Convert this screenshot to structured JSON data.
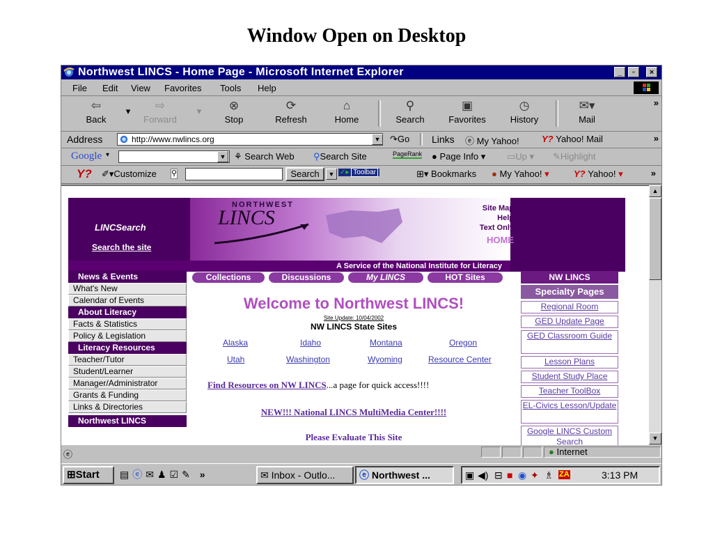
{
  "slide": {
    "title": "Window Open on Desktop"
  },
  "window": {
    "title": "Northwest LINCS - Home Page - Microsoft Internet Explorer",
    "min": "_",
    "max": "▫",
    "close": "×"
  },
  "menu": [
    "File",
    "Edit",
    "View",
    "Favorites",
    "Tools",
    "Help"
  ],
  "toolbar": {
    "back": "Back",
    "forward": "Forward",
    "stop": "Stop",
    "refresh": "Refresh",
    "home": "Home",
    "search": "Search",
    "favorites": "Favorites",
    "history": "History",
    "mail": "Mail",
    "more": "»"
  },
  "address": {
    "label": "Address",
    "url": "http://www.nwlincs.org",
    "go": "Go",
    "links_label": "Links",
    "link1": "My Yahoo!",
    "link2": "Yahoo! Mail",
    "more": "»"
  },
  "googlebar": {
    "logo": "Google",
    "search_web": "Search Web",
    "search_site": "Search Site",
    "pagerank": "PageRank",
    "page_info": "Page Info",
    "up": "Up",
    "highlight": "Highlight"
  },
  "yahoobar": {
    "logo": "Y?",
    "customize": "Customize",
    "search": "Search",
    "toolbar": "Toolbar",
    "bookmarks": "Bookmarks",
    "myyahoo": "My Yahoo!",
    "yahoo": "Yahoo!",
    "more": "»"
  },
  "page": {
    "banner": {
      "linc_search": "LINCSearch",
      "search_site": "Search the site",
      "northwest": "NORTHWEST",
      "lincs": "LINCS",
      "site_map": "Site Map",
      "help": "Help",
      "text_only": "Text Only",
      "home": "HOME",
      "service": "A Service of the National Institute for Literacy"
    },
    "tabs": [
      "Collections",
      "Discussions",
      "My LINCS",
      "HOT Sites"
    ],
    "leftnav": {
      "news_header": "News & Events",
      "news": [
        "What's New",
        "Calendar of Events"
      ],
      "about_header": "About Literacy",
      "about": [
        "Facts & Statistics",
        "Policy & Legislation"
      ],
      "resources_header": "Literacy Resources",
      "resources": [
        "Teacher/Tutor",
        "Student/Learner",
        "Manager/Administrator",
        "Grants & Funding",
        "Links & Directories"
      ],
      "nw_header": "Northwest LINCS"
    },
    "welcome": "Welcome to Northwest LINCS!",
    "site_update": "Site Update: 10/04/2002",
    "state_sites_title": "NW LINCS State Sites",
    "states": [
      "Alaska",
      "Idaho",
      "Montana",
      "Oregon",
      "Utah",
      "Washington",
      "Wyoming",
      "Resource Center"
    ],
    "find_link": "Find Resources on NW LINCS",
    "find_suffix": "...a page for quick access!!!!",
    "new_link": "NEW!!! National LINCS MultiMedia Center!!!!",
    "evaluate": "Please Evaluate This Site",
    "rightcol": {
      "header": "NW LINCS",
      "specialty": "Specialty Pages",
      "items": [
        "Regional Room",
        "GED Update Page",
        "GED Classroom Guide",
        "Lesson Plans",
        "Student Study Place",
        "Teacher ToolBox",
        "EL-Civics Lesson/Update",
        "Google LINCS Custom Search"
      ]
    }
  },
  "status": {
    "zone": "Internet"
  },
  "taskbar": {
    "start": "Start",
    "chevron": "»",
    "task1": "Inbox - Outlo...",
    "task2": "Northwest ...",
    "time": "3:13 PM",
    "tray_za": "ZA"
  },
  "colors": {
    "titlebar": "#000080",
    "lincs_purple": "#4a0060",
    "chrome": "#c0c0c0",
    "welcome": "#b04fc0"
  }
}
